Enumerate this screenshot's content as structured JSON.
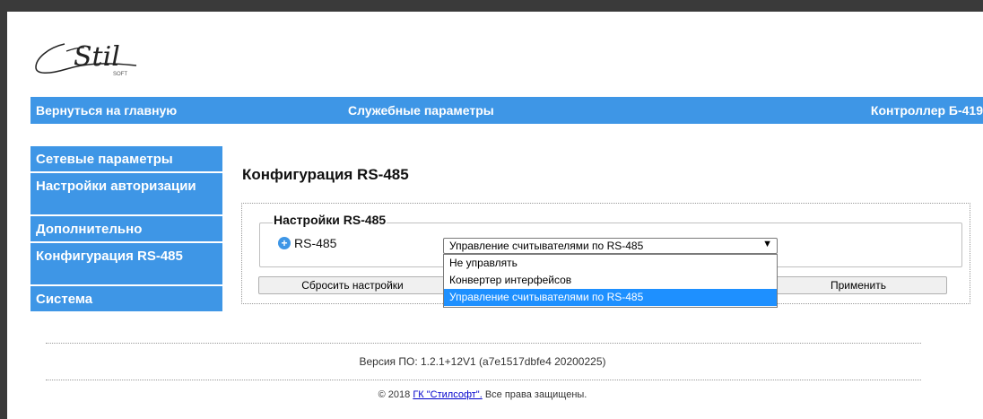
{
  "logo": {
    "wordmark": "Stil",
    "sub": "SOFT"
  },
  "topnav": {
    "home": "Вернуться на главную",
    "service": "Служебные параметры",
    "device": "Контроллер Б-419"
  },
  "sidebar": {
    "items": [
      {
        "label": "Сетевые параметры"
      },
      {
        "label": "Настройки авторизации"
      },
      {
        "label": "Дополнительно"
      },
      {
        "label": "Конфигурация RS-485"
      },
      {
        "label": "Система"
      }
    ]
  },
  "content": {
    "title": "Конфигурация RS-485",
    "fieldset_legend": "Настройки RS-485",
    "row_label": "RS-485",
    "select_value": "Управление считывателями по RS-485",
    "select_arrow": "▼",
    "options": [
      "Не управлять",
      "Конвертер интерфейсов",
      "Управление считывателями по RS-485"
    ],
    "selected_option": 2,
    "reset_label": "Сбросить настройки",
    "apply_label": "Применить"
  },
  "footer": {
    "version": "Версия ПО: 1.2.1+12V1 (a7e1517dbfe4 20200225)",
    "copyright_prefix": "© 2018 ",
    "company_link": "ГК \"Стилсофт\".",
    "copyright_suffix": " Все права защищены."
  },
  "colors": {
    "accent": "#3e96e6",
    "selected_option": "#1e90ff"
  }
}
